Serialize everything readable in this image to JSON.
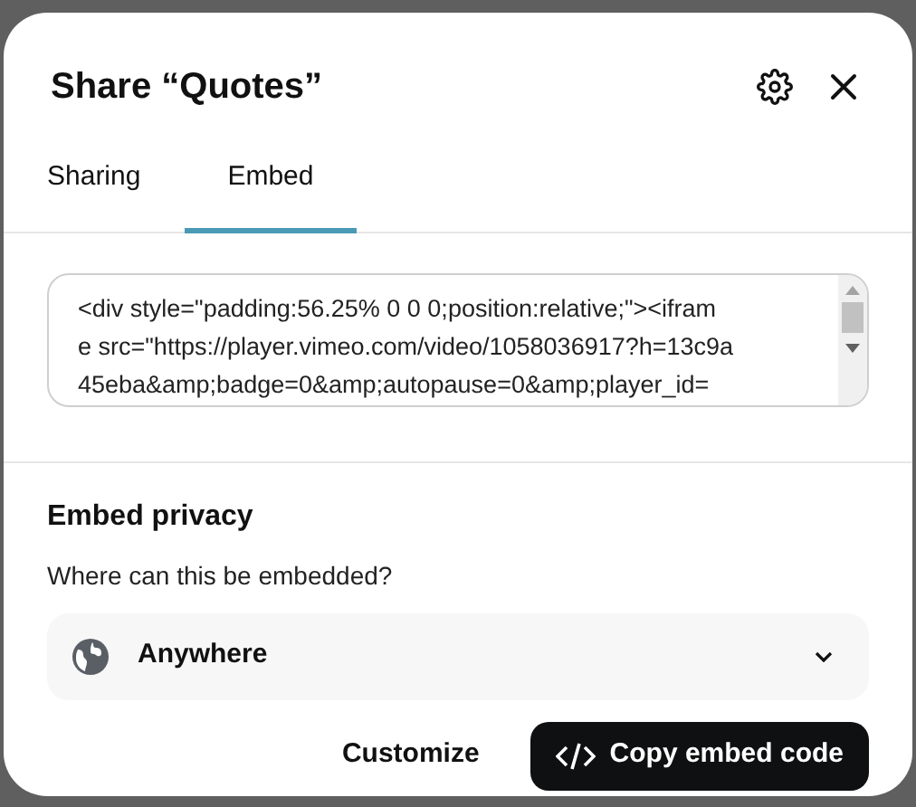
{
  "dialog": {
    "title": "Share “Quotes”"
  },
  "tabs": [
    {
      "label": "Sharing",
      "selected": false
    },
    {
      "label": "Embed",
      "selected": true
    }
  ],
  "embed_code": {
    "lines": [
      "<div style=\"padding:56.25% 0 0 0;position:relative;\"><ifram",
      "e src=\"https://player.vimeo.com/video/1058036917?h=13c9a",
      "45eba&amp;badge=0&amp;autopause=0&amp;player_id="
    ]
  },
  "privacy": {
    "heading": "Embed privacy",
    "question": "Where can this be embedded?",
    "value": "Anywhere"
  },
  "buttons": [
    {
      "label": "Customize",
      "kind": "plain"
    },
    {
      "label": "Copy embed code",
      "kind": "primary"
    }
  ]
}
